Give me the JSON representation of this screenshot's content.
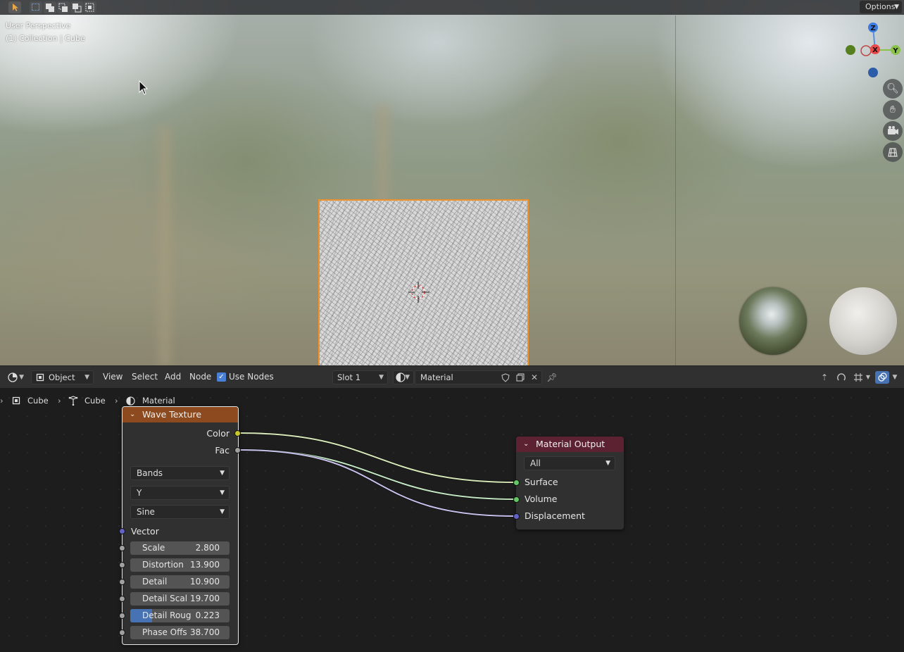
{
  "viewport": {
    "topbar": {
      "options_label": "Options"
    },
    "perspective_label": "User Perspective",
    "collection_label": "(1) Collection | Cube",
    "gizmo": {
      "x": "X",
      "y": "Y",
      "z": "Z"
    }
  },
  "node_editor_header": {
    "editor_type": "Object",
    "menus": [
      "View",
      "Select",
      "Add",
      "Node"
    ],
    "use_nodes_label": "Use Nodes",
    "slot": "Slot 1",
    "material_name": "Material"
  },
  "breadcrumb": {
    "object": "Cube",
    "mesh": "Cube",
    "material": "Material"
  },
  "wave_node": {
    "title": "Wave Texture",
    "outputs": [
      "Color",
      "Fac"
    ],
    "wave_type": "Bands",
    "direction": "Y",
    "profile": "Sine",
    "vector_label": "Vector",
    "fields": [
      {
        "label": "Scale",
        "value": "2.800"
      },
      {
        "label": "Distortion",
        "value": "13.900"
      },
      {
        "label": "Detail",
        "value": "10.900"
      },
      {
        "label": "Detail Scal",
        "value": "19.700"
      },
      {
        "label": "Detail Roug",
        "value": "0.223",
        "fill": 0.223
      },
      {
        "label": "Phase Offs",
        "value": "38.700"
      }
    ]
  },
  "output_node": {
    "title": "Material Output",
    "target": "All",
    "inputs": [
      "Surface",
      "Volume",
      "Displacement"
    ]
  },
  "colors": {
    "accent": "#4772b3",
    "selection": "#f0922c",
    "texture_header": "#8c4a1e",
    "output_header": "#5d2232"
  }
}
